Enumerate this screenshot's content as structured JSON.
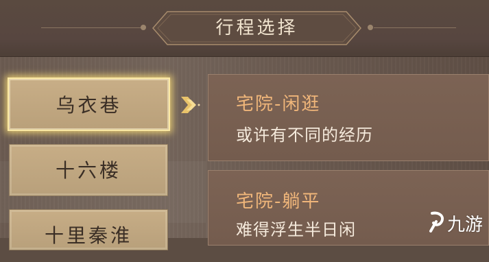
{
  "header": {
    "title": "行程选择"
  },
  "locations": [
    {
      "label": "乌衣巷",
      "selected": true
    },
    {
      "label": "十六楼",
      "selected": false
    },
    {
      "label": "十里秦淮",
      "selected": false
    }
  ],
  "events": [
    {
      "title": "宅院-闲逛",
      "description": "或许有不同的经历"
    },
    {
      "title": "宅院-躺平",
      "description": "难得浮生半日闲"
    }
  ],
  "watermark": {
    "text": "九游"
  },
  "colors": {
    "selected_glow": "#fbe9a4",
    "event_title": "#f0b67a",
    "event_desc": "#f5eadc",
    "button_bg": "#c7ad86"
  }
}
